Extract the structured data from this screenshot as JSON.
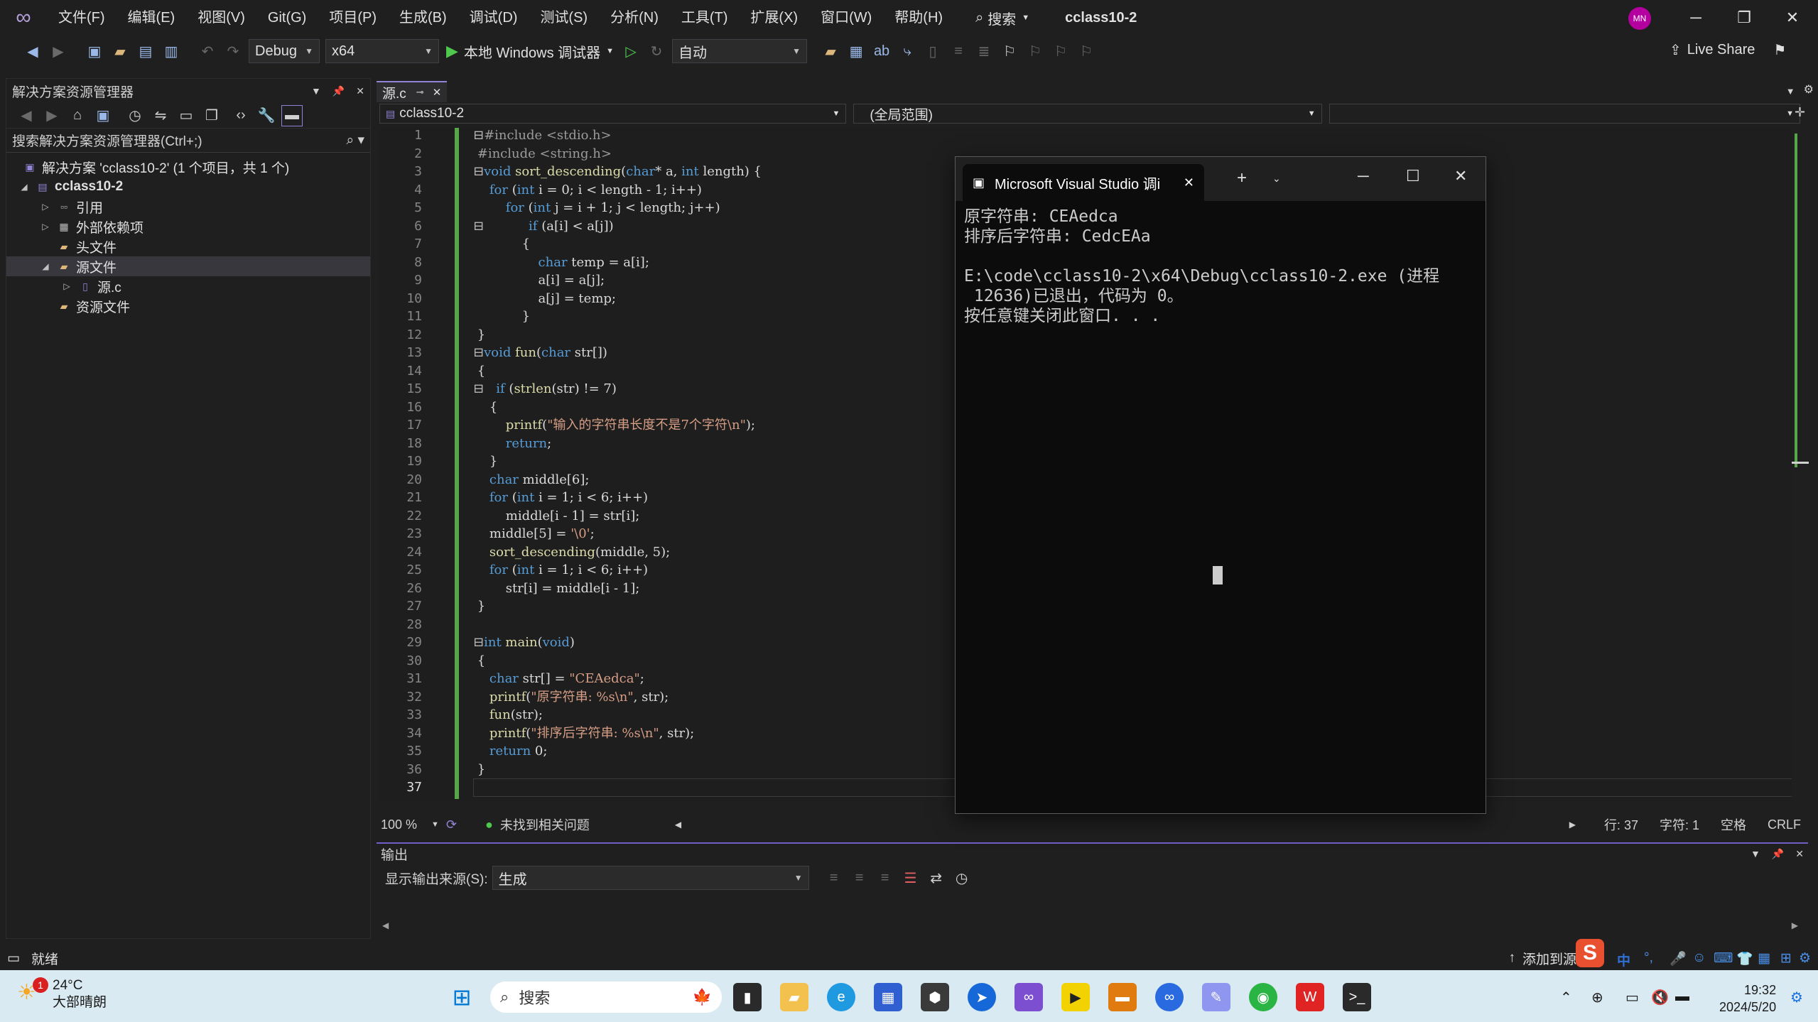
{
  "titlebar": {
    "menus": [
      "文件(F)",
      "编辑(E)",
      "视图(V)",
      "Git(G)",
      "项目(P)",
      "生成(B)",
      "调试(D)",
      "测试(S)",
      "分析(N)",
      "工具(T)",
      "扩展(X)",
      "窗口(W)",
      "帮助(H)"
    ],
    "search_label": "搜索",
    "project_name": "cclass10-2",
    "avatar_initials": "MN"
  },
  "toolbar": {
    "config": "Debug",
    "platform": "x64",
    "run_label": "本地 Windows 调试器",
    "auto": "自动",
    "live_share": "Live Share"
  },
  "solution_explorer": {
    "title": "解决方案资源管理器",
    "search_placeholder": "搜索解决方案资源管理器(Ctrl+;)",
    "items": [
      {
        "label": "解决方案 'cclass10-2' (1 个项目，共 1 个)"
      },
      {
        "label": "cclass10-2"
      },
      {
        "label": "引用"
      },
      {
        "label": "外部依赖项"
      },
      {
        "label": "头文件"
      },
      {
        "label": "源文件"
      },
      {
        "label": "源.c"
      },
      {
        "label": "资源文件"
      }
    ]
  },
  "editor": {
    "tab_label": "源.c",
    "nav_project": "cclass10-2",
    "nav_scope": "(全局范围)",
    "zoom": "100 %",
    "issues": "未找到相关问题",
    "line": "行: 37",
    "col": "字符: 1",
    "spaces": "空格",
    "eol": "CRLF"
  },
  "output": {
    "title": "输出",
    "source_label": "显示输出来源(S):",
    "source_value": "生成"
  },
  "statusbar": {
    "ready": "就绪",
    "add_source": "添加到源"
  },
  "console": {
    "title": "Microsoft Visual Studio 调i",
    "lines": [
      "原字符串: CEAedca",
      "排序后字符串: CedcEAa",
      "",
      "E:\\code\\cclass10-2\\x64\\Debug\\cclass10-2.exe (进程",
      " 12636)已退出，代码为 0。",
      "按任意键关闭此窗口. . ."
    ]
  },
  "taskbar": {
    "temp": "24°C",
    "weather": "大部晴朗",
    "badge": "1",
    "search": "搜索",
    "time": "19:32",
    "date": "2024/5/20",
    "ime_lang": "中"
  }
}
